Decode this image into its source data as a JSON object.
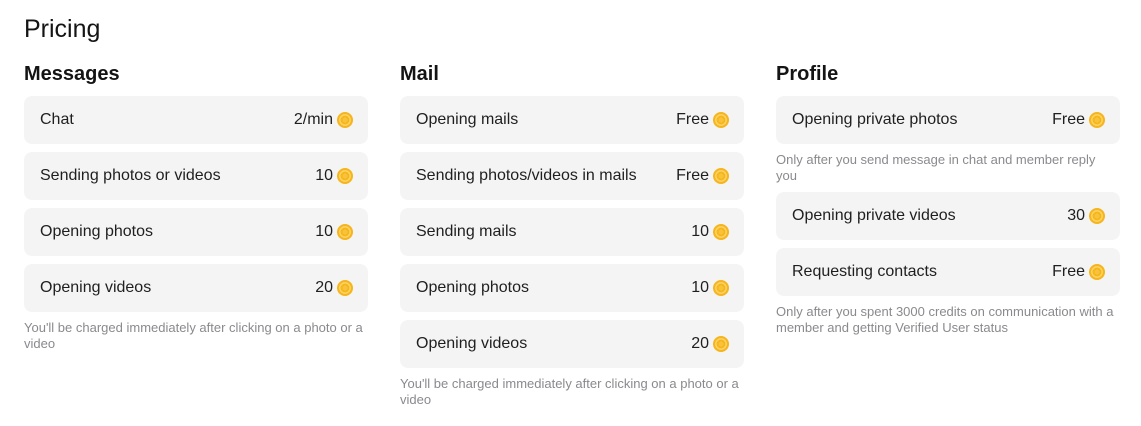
{
  "page": {
    "title": "Pricing"
  },
  "colors": {
    "coin": "#f5b51c",
    "row_bg": "#f4f4f4",
    "note_text": "#8a8a8e"
  },
  "messages": {
    "title": "Messages",
    "rows": [
      {
        "label": "Chat",
        "price": "2/min",
        "icon": "coin-icon"
      },
      {
        "label": "Sending photos or videos",
        "price": "10",
        "icon": "coin-icon"
      },
      {
        "label": "Opening photos",
        "price": "10",
        "icon": "coin-icon"
      },
      {
        "label": "Opening videos",
        "price": "20",
        "icon": "coin-icon"
      }
    ],
    "note": "You'll be charged immediately after clicking on a photo or a video"
  },
  "mail": {
    "title": "Mail",
    "rows": [
      {
        "label": "Opening mails",
        "price": "Free",
        "icon": "coin-icon"
      },
      {
        "label": "Sending photos/videos in mails",
        "price": "Free",
        "icon": "coin-icon"
      },
      {
        "label": "Sending mails",
        "price": "10",
        "icon": "coin-icon"
      },
      {
        "label": "Opening photos",
        "price": "10",
        "icon": "coin-icon"
      },
      {
        "label": "Opening videos",
        "price": "20",
        "icon": "coin-icon"
      }
    ],
    "note": "You'll be charged immediately after clicking on a photo or a video"
  },
  "profile": {
    "title": "Profile",
    "rows": [
      {
        "label": "Opening private photos",
        "price": "Free",
        "icon": "coin-icon",
        "note": "Only after you send message in chat and member reply you"
      },
      {
        "label": "Opening private videos",
        "price": "30",
        "icon": "coin-icon"
      },
      {
        "label": "Requesting contacts",
        "price": "Free",
        "icon": "coin-icon",
        "note": "Only after you spent 3000 credits on communication with a member and getting Verified User status"
      }
    ]
  }
}
